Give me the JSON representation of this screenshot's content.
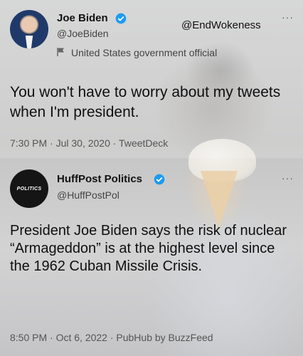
{
  "overlay": {
    "handle": "@EndWokeness"
  },
  "tweet1": {
    "author_name": "Joe Biden",
    "author_handle": "@JoeBiden",
    "label": "United States government official",
    "text": "You won't have to worry about my tweets when I'm president.",
    "meta": "7:30 PM · Jul 30, 2020 · TweetDeck",
    "more": "···"
  },
  "tweet2": {
    "avatar_text": "POLITICS",
    "author_name": "HuffPost Politics",
    "author_handle": "@HuffPostPol",
    "text": "President Joe Biden says the risk of nuclear “Armageddon” is at the highest level since the 1962 Cuban Missile Crisis.",
    "meta": "8:50 PM · Oct 6, 2022 · PubHub by BuzzFeed",
    "more": "···"
  },
  "colors": {
    "verified": "#1d9bf0"
  },
  "icons": [
    "verified-badge-icon",
    "flag-icon",
    "more-icon"
  ]
}
